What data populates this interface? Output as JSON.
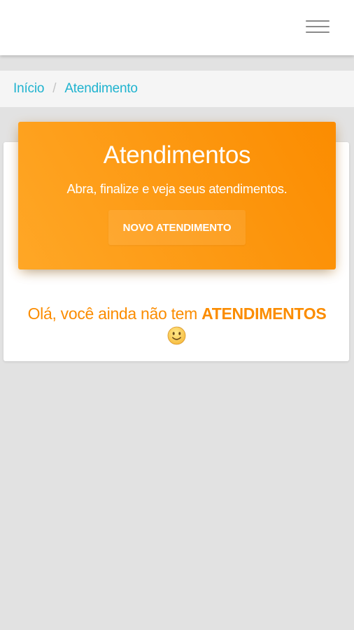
{
  "topbar": {
    "menu_icon": "hamburger-menu-icon"
  },
  "breadcrumb": {
    "items": [
      {
        "label": "Início"
      },
      {
        "label": "Atendimento"
      }
    ],
    "separator": "/"
  },
  "panel": {
    "title": "Atendimentos",
    "subtitle": "Abra, finalize e veja seus atendimentos.",
    "button_label": "NOVO ATENDIMENTO"
  },
  "empty_state": {
    "text": "Olá, você ainda não tem ",
    "emphasis": "ATENDIMENTOS",
    "icon": "smiley-face-icon"
  },
  "colors": {
    "accent_orange": "#fb8c00",
    "link_cyan": "#1fb3cf",
    "background": "#e2e2e2"
  }
}
